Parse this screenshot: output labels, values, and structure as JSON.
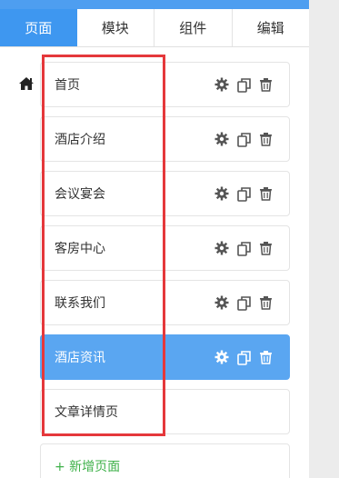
{
  "tabs": [
    {
      "label": "页面",
      "active": true
    },
    {
      "label": "模块",
      "active": false
    },
    {
      "label": "组件",
      "active": false
    },
    {
      "label": "编辑",
      "active": false
    }
  ],
  "icons": {
    "home": "home-icon",
    "settings": "gear-icon",
    "copy": "copy-icon",
    "delete": "trash-icon"
  },
  "pages": [
    {
      "label": "首页",
      "selected": false,
      "has_actions": true
    },
    {
      "label": "酒店介绍",
      "selected": false,
      "has_actions": true
    },
    {
      "label": "会议宴会",
      "selected": false,
      "has_actions": true
    },
    {
      "label": "客房中心",
      "selected": false,
      "has_actions": true
    },
    {
      "label": "联系我们",
      "selected": false,
      "has_actions": true
    },
    {
      "label": "酒店资讯",
      "selected": true,
      "has_actions": true
    },
    {
      "label": "文章详情页",
      "selected": false,
      "has_actions": false
    }
  ],
  "add_page_label": "+ 新增页面",
  "colors": {
    "accent": "#3e97f0",
    "selected_item": "#5aa6f1",
    "add_text": "#3fb14a",
    "annotation": "#e5383b"
  }
}
